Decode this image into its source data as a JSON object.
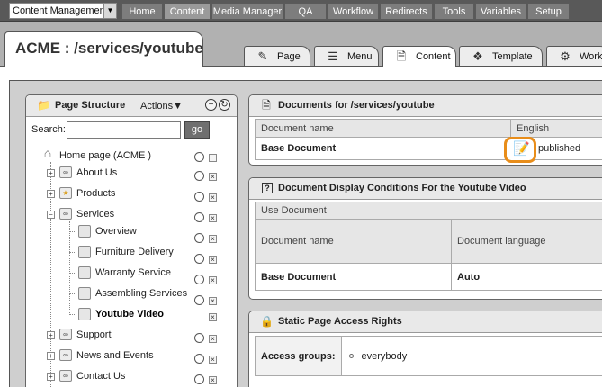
{
  "top_nav": {
    "selector_value": "Content Management",
    "items": [
      {
        "label": "Home",
        "active": false
      },
      {
        "label": "Content",
        "active": true
      },
      {
        "label": "Media Manager",
        "active": false
      },
      {
        "label": "QA",
        "active": false
      },
      {
        "label": "Workflow",
        "active": false
      },
      {
        "label": "Redirects",
        "active": false
      },
      {
        "label": "Tools",
        "active": false
      },
      {
        "label": "Variables",
        "active": false
      },
      {
        "label": "Setup",
        "active": false
      }
    ]
  },
  "page_title": "ACME : /services/youtube",
  "page_tabs": [
    {
      "label": "Page",
      "icon": "page-settings-icon"
    },
    {
      "label": "Menu",
      "icon": "menu-icon"
    },
    {
      "label": "Content",
      "icon": "document-icon",
      "active": true
    },
    {
      "label": "Template",
      "icon": "template-icon"
    },
    {
      "label": "Workflow",
      "icon": "workflow-icon"
    }
  ],
  "page_structure": {
    "title": "Page Structure",
    "actions_label": "Actions▼",
    "search_label": "Search:",
    "search_value": "",
    "go_label": "go",
    "tree": [
      {
        "label": "Home page (ACME )",
        "icon": "home-icon"
      },
      {
        "label": "About Us",
        "icon": "link-page-icon"
      },
      {
        "label": "Products",
        "icon": "star-page-icon"
      },
      {
        "label": "Services",
        "icon": "link-page-icon"
      },
      {
        "label": "Overview",
        "icon": "page-icon"
      },
      {
        "label": "Furniture Delivery",
        "icon": "page-icon"
      },
      {
        "label": "Warranty Service",
        "icon": "page-icon"
      },
      {
        "label": "Assembling Services",
        "icon": "page-icon"
      },
      {
        "label": "Youtube Video",
        "icon": "page-icon",
        "selected": true
      },
      {
        "label": "Support",
        "icon": "link-page-icon"
      },
      {
        "label": "News and Events",
        "icon": "link-page-icon"
      },
      {
        "label": "Contact Us",
        "icon": "link-page-icon"
      }
    ]
  },
  "documents_panel": {
    "title": "Documents for /services/youtube",
    "col_name": "Document name",
    "col_lang": "English",
    "row_name": "Base Document",
    "row_status": "published"
  },
  "conditions_panel": {
    "title": "Document Display Conditions For the Youtube Video",
    "use_document": "Use Document",
    "col_name": "Document name",
    "col_lang": "Document language",
    "row_name": "Base Document",
    "row_lang": "Auto"
  },
  "access_panel": {
    "title": "Static Page Access Rights",
    "groups_label": "Access groups:",
    "groups": [
      "everybody"
    ]
  },
  "colors": {
    "nav_bg": "#595959",
    "highlight": "#e88d1a"
  }
}
